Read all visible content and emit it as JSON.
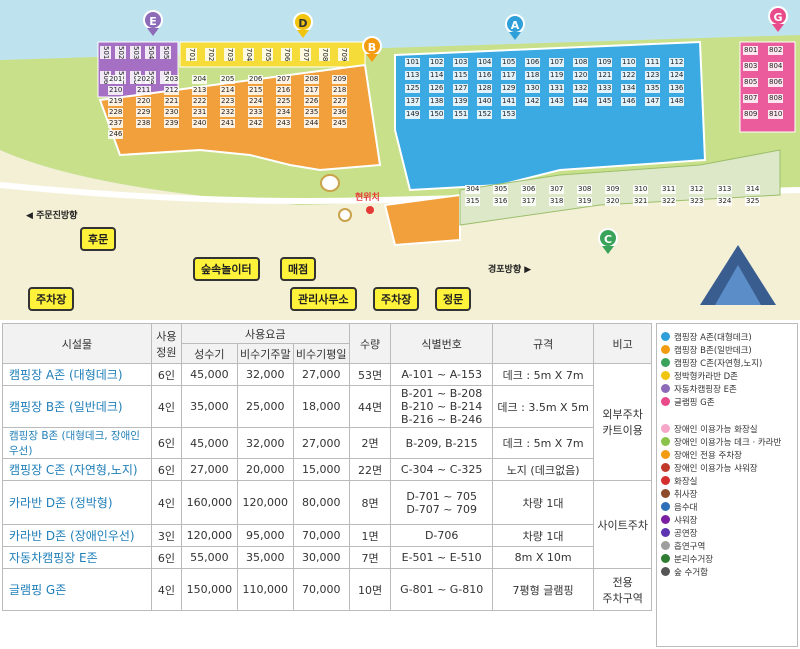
{
  "map": {
    "zone_markers": [
      {
        "letter": "E",
        "color": "#8e6bb8"
      },
      {
        "letter": "D",
        "color": "#f1c40f"
      },
      {
        "letter": "B",
        "color": "#f39c12"
      },
      {
        "letter": "A",
        "color": "#2e9fd8"
      },
      {
        "letter": "G",
        "color": "#e84a8a"
      },
      {
        "letter": "C",
        "color": "#3aa35a"
      }
    ],
    "callouts": {
      "back_gate": "후문",
      "parking_left": "주차장",
      "forest_play": "숲속놀이터",
      "store": "매점",
      "office": "관리사무소",
      "parking_center": "주차장",
      "main_gate": "정문",
      "you_are_here": "현위치"
    },
    "roads": {
      "jumunjin": "주문진방향",
      "gyeongpo": "경포방향"
    },
    "sites": {
      "E": [
        "501",
        "502",
        "503",
        "504",
        "505",
        "506",
        "507",
        "508",
        "509",
        "510"
      ],
      "D": [
        "701",
        "702",
        "703",
        "704",
        "705",
        "706",
        "707",
        "708",
        "709"
      ],
      "B": [
        "201",
        "202",
        "203",
        "204",
        "205",
        "206",
        "207",
        "208",
        "209",
        "210",
        "211",
        "212",
        "213",
        "214",
        "215",
        "216",
        "217",
        "218",
        "219",
        "220",
        "221",
        "222",
        "223",
        "224",
        "225",
        "226",
        "227",
        "228",
        "229",
        "230",
        "231",
        "232",
        "233",
        "234",
        "235",
        "236",
        "237",
        "238",
        "239",
        "240",
        "241",
        "242",
        "243",
        "244",
        "245",
        "246"
      ],
      "A": [
        "101",
        "102",
        "103",
        "104",
        "105",
        "106",
        "107",
        "108",
        "109",
        "110",
        "111",
        "112",
        "113",
        "114",
        "115",
        "116",
        "117",
        "118",
        "119",
        "120",
        "121",
        "122",
        "123",
        "124",
        "125",
        "126",
        "127",
        "128",
        "129",
        "130",
        "131",
        "132",
        "133",
        "134",
        "135",
        "136",
        "137",
        "138",
        "139",
        "140",
        "141",
        "142",
        "143",
        "144",
        "145",
        "146",
        "147",
        "148",
        "149",
        "150",
        "151",
        "152",
        "153"
      ],
      "C": [
        "304",
        "305",
        "306",
        "307",
        "308",
        "309",
        "310",
        "311",
        "312",
        "313",
        "314",
        "315",
        "316",
        "317",
        "318",
        "319",
        "320",
        "321",
        "322",
        "323",
        "324",
        "325"
      ],
      "G": [
        "801",
        "802",
        "803",
        "804",
        "805",
        "806",
        "807",
        "808",
        "809",
        "810"
      ]
    }
  },
  "table": {
    "headers": {
      "facility": "시설물",
      "capacity": "사용\n정원",
      "fee": "사용요금",
      "peak": "성수기",
      "offpeak_weekend": "비수기주말",
      "offpeak_weekday": "비수기평일",
      "count": "수량",
      "ids": "식별번호",
      "spec": "규격",
      "note": "비고"
    },
    "rows": [
      {
        "facility": "캠핑장 A존 (대형데크)",
        "capacity": "6인",
        "peak": "45,000",
        "weekend": "32,000",
        "weekday": "27,000",
        "count": "53면",
        "ids": "A-101 ~ A-153",
        "spec": "데크 : 5m X 7m"
      },
      {
        "facility": "캠핑장 B존 (일반데크)",
        "capacity": "4인",
        "peak": "35,000",
        "weekend": "25,000",
        "weekday": "18,000",
        "count": "44면",
        "ids": "B-201 ~ B-208\nB-210 ~ B-214\nB-216 ~ B-246",
        "spec": "데크 : 3.5m X 5m"
      },
      {
        "facility": "캠핑장 B존 (대형데크, 장애인우선)",
        "capacity": "6인",
        "peak": "45,000",
        "weekend": "32,000",
        "weekday": "27,000",
        "count": "2면",
        "ids": "B-209, B-215",
        "spec": "데크 : 5m X 7m"
      },
      {
        "facility": "캠핑장 C존 (자연형,노지)",
        "capacity": "6인",
        "peak": "27,000",
        "weekend": "20,000",
        "weekday": "15,000",
        "count": "22면",
        "ids": "C-304 ~ C-325",
        "spec": "노지 (데크없음)"
      },
      {
        "facility": "카라반 D존 (정박형)",
        "capacity": "4인",
        "peak": "160,000",
        "weekend": "120,000",
        "weekday": "80,000",
        "count": "8면",
        "ids": "D-701 ~ 705\nD-707 ~ 709",
        "spec": "차량 1대"
      },
      {
        "facility": "카라반 D존 (장애인우선)",
        "capacity": "3인",
        "peak": "120,000",
        "weekend": "95,000",
        "weekday": "70,000",
        "count": "1면",
        "ids": "D-706",
        "spec": "차량 1대"
      },
      {
        "facility": "자동차캠핑장 E존",
        "capacity": "6인",
        "peak": "55,000",
        "weekend": "35,000",
        "weekday": "30,000",
        "count": "7면",
        "ids": "E-501 ~ E-510",
        "spec": "8m X 10m"
      },
      {
        "facility": "글램핑 G존",
        "capacity": "4인",
        "peak": "150,000",
        "weekend": "110,000",
        "weekday": "70,000",
        "count": "10면",
        "ids": "G-801 ~ G-810",
        "spec": "7평형 글램핑"
      }
    ],
    "notes": {
      "outside_parking": "외부주차\n카트이용",
      "site_parking": "사이트주차",
      "private_parking": "전용\n주차구역"
    }
  },
  "legend": {
    "zones": [
      {
        "label": "캠핑장 A존(대형데크)",
        "color": "#2e9fd8"
      },
      {
        "label": "캠핑장 B존(일반데크)",
        "color": "#f39c12"
      },
      {
        "label": "캠핑장 C존(자연형,노지)",
        "color": "#3aa35a"
      },
      {
        "label": "정박형카라반 D존",
        "color": "#f1c40f"
      },
      {
        "label": "자동차캠핑장 E존",
        "color": "#8e6bb8"
      },
      {
        "label": "글램핑 G존",
        "color": "#e84a8a"
      }
    ],
    "facilities": [
      {
        "label": "장애인 이용가능 화장실",
        "color": "#f6a6c8"
      },
      {
        "label": "장애인 이용가능 데크 · 카라반",
        "color": "#8bc34a"
      },
      {
        "label": "장애인 전용 주차장",
        "color": "#f39c12"
      },
      {
        "label": "장애인 이용가능 샤워장",
        "color": "#c0392b"
      },
      {
        "label": "화장실",
        "color": "#d32f2f"
      },
      {
        "label": "취사장",
        "color": "#8d4b2b"
      },
      {
        "label": "음수대",
        "color": "#2e6fb8"
      },
      {
        "label": "샤워장",
        "color": "#7b1fa2"
      },
      {
        "label": "공연장",
        "color": "#5e35b1"
      },
      {
        "label": "흡연구역",
        "color": "#9e9e9e"
      },
      {
        "label": "분리수거장",
        "color": "#2e7d32"
      },
      {
        "label": "숲 수거함",
        "color": "#555555"
      }
    ]
  }
}
